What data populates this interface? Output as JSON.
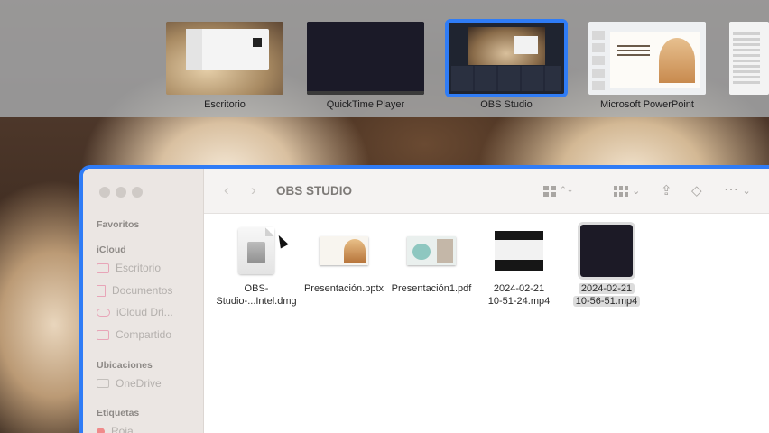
{
  "switcher": {
    "apps": [
      {
        "label": "Escritorio",
        "icon": "desktop-thumbnail"
      },
      {
        "label": "QuickTime Player",
        "icon": "quicktime-thumbnail"
      },
      {
        "label": "OBS Studio",
        "icon": "obs-thumbnail",
        "selected": true
      },
      {
        "label": "Microsoft PowerPoint",
        "icon": "powerpoint-thumbnail"
      },
      {
        "label": "",
        "icon": "app-thumbnail"
      }
    ]
  },
  "finder": {
    "title": "OBS STUDIO",
    "accent": "#2f7cf6",
    "toolbar": {
      "back_icon": "chevron-left-icon",
      "forward_icon": "chevron-right-icon",
      "view_icon": "icon-grid-icon",
      "group_icon": "group-grid-icon",
      "share_icon": "share-icon",
      "tag_icon": "tag-icon",
      "more_icon": "more-icon",
      "back_glyph": "‹",
      "forward_glyph": "›",
      "updown_glyph": "⌃⌄",
      "down_glyph": "⌄",
      "share_glyph": "⇪",
      "tag_glyph": "◇",
      "more_glyph": "⋯"
    },
    "sidebar": {
      "favorites_title": "Favoritos",
      "icloud_title": "iCloud",
      "icloud_items": [
        "Escritorio",
        "Documentos",
        "iCloud Dri...",
        "Compartido"
      ],
      "locations_title": "Ubicaciones",
      "location_items": [
        "OneDrive"
      ],
      "tags_title": "Etiquetas",
      "tag_items": [
        "Roja"
      ]
    },
    "files": [
      {
        "line1": "OBS-",
        "line2": "Studio-...Intel.dmg"
      },
      {
        "line1": "Presentación.pptx",
        "line2": ""
      },
      {
        "line1": "Presentación1.pdf",
        "line2": ""
      },
      {
        "line1": "2024-02-21",
        "line2": "10-51-24.mp4"
      },
      {
        "line1": "2024-02-21",
        "line2": "10-56-51.mp4",
        "selected": true
      }
    ]
  }
}
